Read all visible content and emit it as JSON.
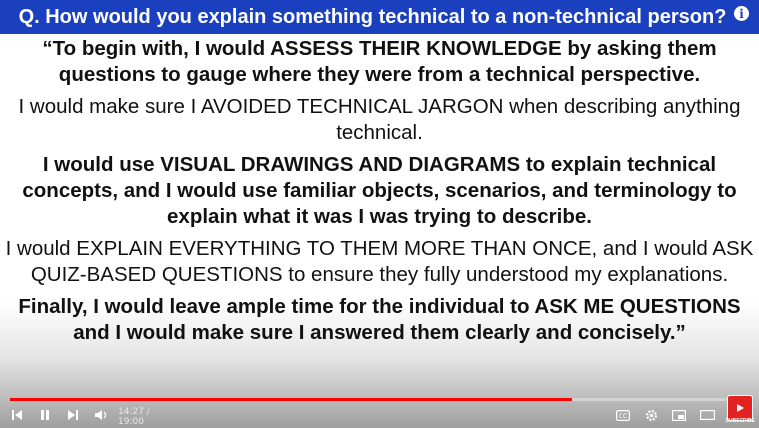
{
  "slide": {
    "title": "Q. How would you explain something technical to a non-technical person?",
    "info_glyph": "i",
    "paragraphs": [
      "“To begin with, I would ASSESS THEIR KNOWLEDGE by asking them questions to gauge where they were from a technical perspective.",
      "I would make sure I AVOIDED TECHNICAL JARGON when describing anything technical.",
      "I would use VISUAL DRAWINGS AND DIAGRAMS to explain technical concepts, and I would use familiar objects, scenarios, and terminology to explain what it was I was trying to describe.",
      "I would EXPLAIN EVERYTHING TO THEM MORE THAN ONCE, and I would ASK QUIZ-BASED QUESTIONS to ensure they fully understood my explanations.",
      "Finally, I would leave ample time for the individual to ASK ME QUESTIONS and I would make sure I answered them clearly and concisely.”"
    ]
  },
  "player": {
    "time_display": "14:27 / 19:00",
    "progress_fraction": 0.761,
    "icons": {
      "prev": "skip-previous-icon",
      "pause": "pause-icon",
      "next": "skip-next-icon",
      "volume": "volume-icon",
      "captions": "closed-captions-icon",
      "settings": "settings-icon",
      "miniplayer": "miniplayer-icon",
      "theater": "theater-mode-icon",
      "fullscreen": "fullscreen-icon",
      "subscribe": "subscribe-icon"
    },
    "subscribe_label": "SUBSCRIBE",
    "colors": {
      "title_bar": "#1a3fbf",
      "progress": "#ff0000",
      "subscribe": "#e32222"
    }
  }
}
